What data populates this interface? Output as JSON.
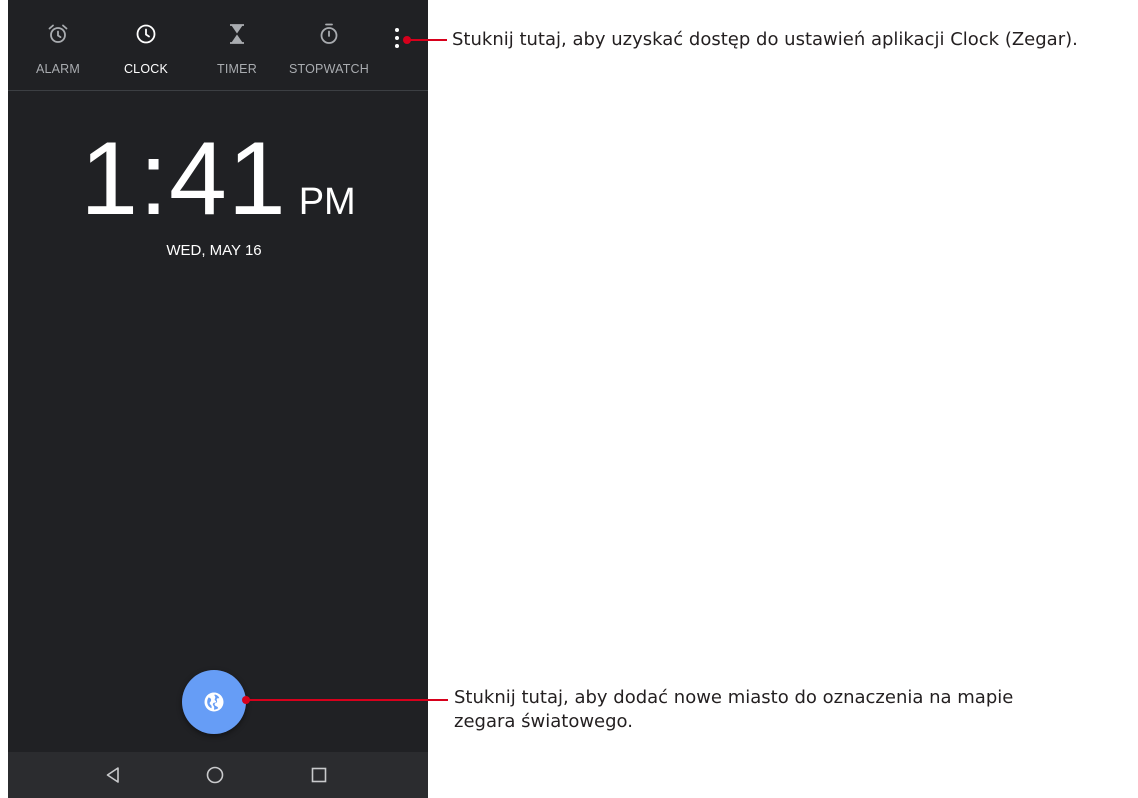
{
  "tabs": [
    {
      "label": "ALARM",
      "icon": "alarm-icon"
    },
    {
      "label": "CLOCK",
      "icon": "clock-icon",
      "active": true
    },
    {
      "label": "TIMER",
      "icon": "hourglass-icon"
    },
    {
      "label": "STOPWATCH",
      "icon": "stopwatch-icon"
    }
  ],
  "menu_icon": "more-vert-icon",
  "clock": {
    "time": "1:41",
    "ampm": "PM",
    "date": "WED, MAY 16"
  },
  "fab_icon": "globe-icon",
  "nav": [
    "back-icon",
    "home-icon",
    "recents-icon"
  ],
  "annotations": {
    "menu": "Stuknij tutaj, aby uzyskać dostęp do ustawień aplikacji Clock (Zegar).",
    "fab_line1": "Stuknij tutaj, aby dodać nowe miasto do oznaczenia na mapie",
    "fab_line2": "zegara światowego."
  },
  "colors": {
    "screen_bg": "#202124",
    "fab": "#669df6",
    "annotation_line": "#d7001c"
  }
}
